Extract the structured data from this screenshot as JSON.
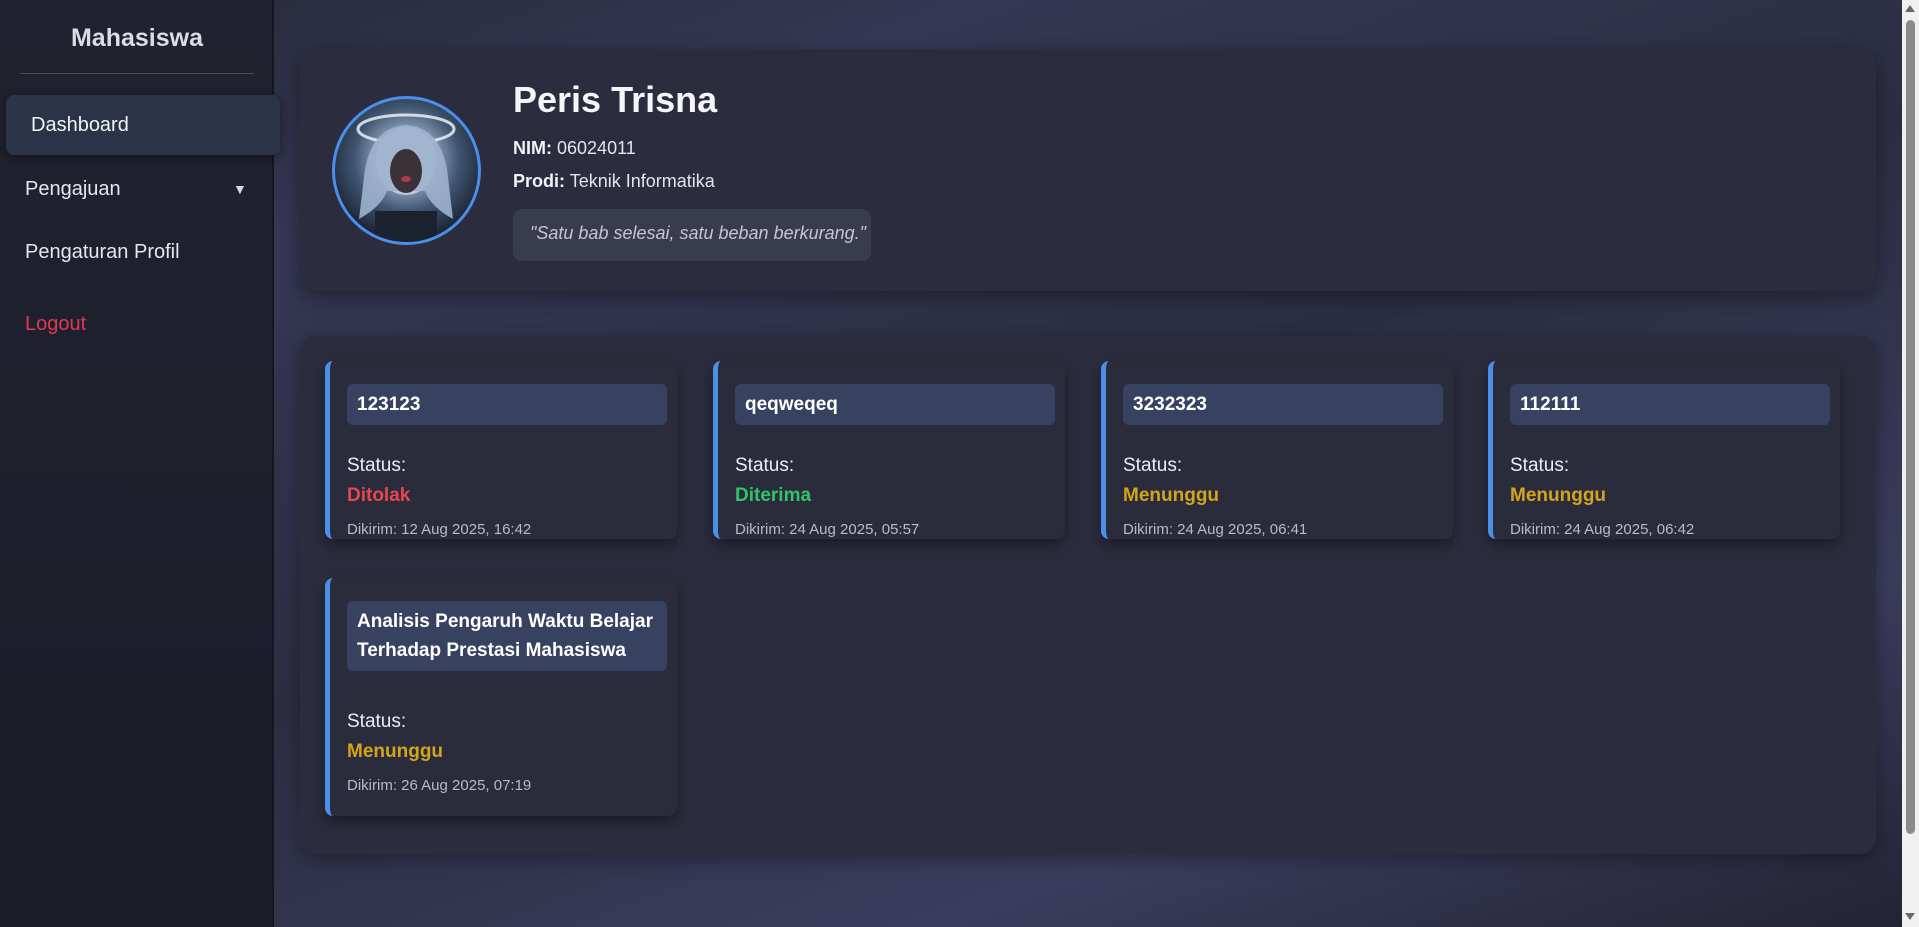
{
  "sidebar": {
    "title": "Mahasiswa",
    "items": [
      {
        "label": "Dashboard"
      },
      {
        "label": "Pengajuan"
      },
      {
        "label": "Pengaturan Profil"
      },
      {
        "label": "Logout"
      }
    ],
    "dropdown_arrow": "▼"
  },
  "profile": {
    "name": "Peris Trisna",
    "nim_label": "NIM:",
    "nim": "06024011",
    "prodi_label": "Prodi:",
    "prodi": "Teknik Informatika",
    "quote": "\"Satu bab selesai, satu beban berkurang.\""
  },
  "submissions": [
    {
      "title": "123123",
      "status_label": "Status:",
      "status": "Ditolak",
      "status_color": "#e8474e",
      "date": "Dikirim: 12 Aug 2025, 16:42"
    },
    {
      "title": "qeqweqeq",
      "status_label": "Status:",
      "status": "Diterima",
      "status_color": "#2fc46b",
      "date": "Dikirim: 24 Aug 2025, 05:57"
    },
    {
      "title": "3232323",
      "status_label": "Status:",
      "status": "Menunggu",
      "status_color": "#d4a51c",
      "date": "Dikirim: 24 Aug 2025, 06:41"
    },
    {
      "title": "112111",
      "status_label": "Status:",
      "status": "Menunggu",
      "status_color": "#d4a51c",
      "date": "Dikirim: 24 Aug 2025, 06:42"
    },
    {
      "title": "Analisis Pengaruh Waktu Belajar Terhadap Prestasi Mahasiswa",
      "status_label": "Status:",
      "status": "Menunggu",
      "status_color": "#d4a51c",
      "date": "Dikirim: 26 Aug 2025, 07:19"
    }
  ]
}
